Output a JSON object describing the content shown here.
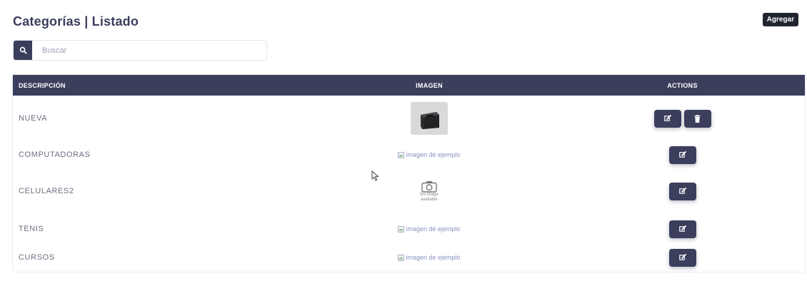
{
  "header": {
    "title": "Categorías | Listado",
    "add_label": "Agregar"
  },
  "search": {
    "placeholder": "Buscar",
    "value": ""
  },
  "table": {
    "columns": [
      "DESCRIPCIÓN",
      "IMAGEN",
      "ACTIONS"
    ],
    "rows": [
      {
        "description": "NUEVA",
        "image": "printer-photo",
        "image_alt": "",
        "actions": [
          "edit",
          "delete"
        ]
      },
      {
        "description": "COMPUTADORAS",
        "image": "broken",
        "image_alt": "imagen de ejemplo",
        "actions": [
          "edit"
        ]
      },
      {
        "description": "CELULARES2",
        "image": "no-image",
        "image_alt": "No image available",
        "no_image_line1": "No image",
        "no_image_line2": "available",
        "actions": [
          "edit"
        ]
      },
      {
        "description": "TENIS",
        "image": "broken",
        "image_alt": "imagen de ejemplo",
        "actions": [
          "edit"
        ]
      },
      {
        "description": "CURSOS",
        "image": "broken",
        "image_alt": "imagen de ejemplo",
        "actions": [
          "edit"
        ]
      }
    ]
  },
  "colors": {
    "primary": "#3b3f5c",
    "add_button": "#1f2430",
    "link_text": "#8a92c2"
  },
  "icons": {
    "search": "search-icon",
    "edit": "edit-icon",
    "delete": "trash-icon",
    "camera": "camera-icon",
    "cursor": "mouse-cursor-icon"
  }
}
